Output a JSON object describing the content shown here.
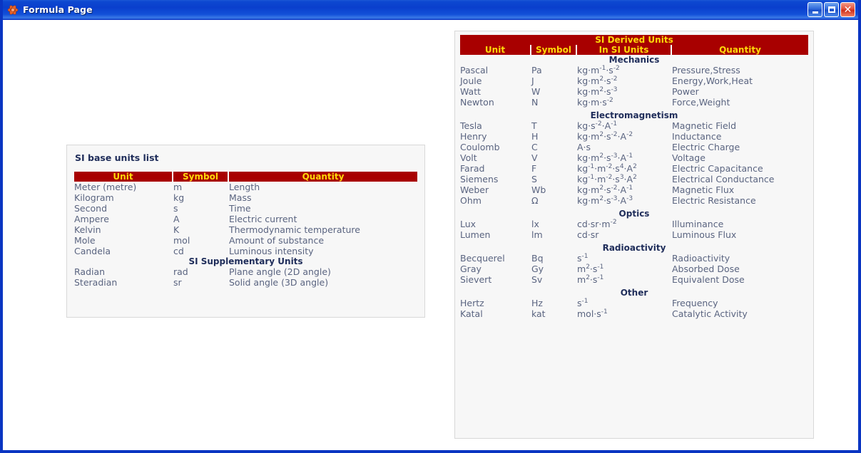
{
  "window": {
    "title": "Formula Page",
    "icon": "atom-icon",
    "buttons": {
      "minimize": "Minimize",
      "maximize": "Maximize",
      "close": "Close"
    },
    "colors": {
      "titlebar_blue": "#0a3fcd",
      "border_blue": "#0a35c2",
      "table_header_red": "#a80000",
      "header_text_yellow": "#ffd90a",
      "section_text_navy": "#1f2d5a",
      "body_text_slate": "#5a6480",
      "panel_background": "#f7f7f7"
    }
  },
  "base_units_panel": {
    "heading": "SI base units list",
    "columns": [
      "Unit",
      "Symbol",
      "Quantity"
    ],
    "rows": [
      {
        "unit": "Meter (metre)",
        "symbol": "m",
        "quantity": "Length"
      },
      {
        "unit": "Kilogram",
        "symbol": "kg",
        "quantity": "Mass"
      },
      {
        "unit": "Second",
        "symbol": "s",
        "quantity": "Time"
      },
      {
        "unit": "Ampere",
        "symbol": "A",
        "quantity": "Electric current"
      },
      {
        "unit": "Kelvin",
        "symbol": "K",
        "quantity": "Thermodynamic temperature"
      },
      {
        "unit": "Mole",
        "symbol": "mol",
        "quantity": "Amount of substance"
      },
      {
        "unit": "Candela",
        "symbol": "cd",
        "quantity": "Luminous intensity"
      }
    ],
    "supplementary_section": "SI Supplementary Units",
    "supplementary_rows": [
      {
        "unit": "Radian",
        "symbol": "rad",
        "quantity": "Plane angle (2D angle)"
      },
      {
        "unit": "Steradian",
        "symbol": "sr",
        "quantity": "Solid angle (3D angle)"
      }
    ]
  },
  "derived_units_panel": {
    "title": "SI Derived Units",
    "columns": [
      "Unit",
      "Symbol",
      "In SI Units",
      "Quantity"
    ],
    "sections": [
      {
        "name": "Mechanics",
        "rows": [
          {
            "unit": "Pascal",
            "symbol": "Pa",
            "si": "kg·m<sup>-1</sup>·s<sup>-2</sup>",
            "quantity": "Pressure,Stress"
          },
          {
            "unit": "Joule",
            "symbol": "J",
            "si": "kg·m<sup>2</sup>·s<sup>-2</sup>",
            "quantity": "Energy,Work,Heat"
          },
          {
            "unit": "Watt",
            "symbol": "W",
            "si": "kg·m<sup>2</sup>·s<sup>-3</sup>",
            "quantity": "Power"
          },
          {
            "unit": "Newton",
            "symbol": "N",
            "si": "kg·m·s<sup>-2</sup>",
            "quantity": "Force,Weight"
          }
        ]
      },
      {
        "name": "Electromagnetism",
        "rows": [
          {
            "unit": "Tesla",
            "symbol": "T",
            "si": "kg·s<sup>-2</sup>·A<sup>-1</sup>",
            "quantity": "Magnetic Field"
          },
          {
            "unit": "Henry",
            "symbol": "H",
            "si": "kg·m<sup>2</sup>·s<sup>-2</sup>·A<sup>-2</sup>",
            "quantity": "Inductance"
          },
          {
            "unit": "Coulomb",
            "symbol": "C",
            "si": "A·s",
            "quantity": "Electric Charge"
          },
          {
            "unit": "Volt",
            "symbol": "V",
            "si": "kg·m<sup>2</sup>·s<sup>-3</sup>·A<sup>-1</sup>",
            "quantity": "Voltage"
          },
          {
            "unit": "Farad",
            "symbol": "F",
            "si": "kg<sup>-1</sup>·m<sup>-2</sup>·s<sup>4</sup>·A<sup>2</sup>",
            "quantity": "Electric Capacitance"
          },
          {
            "unit": "Siemens",
            "symbol": "S",
            "si": "kg<sup>-1</sup>·m<sup>-2</sup>·s<sup>3</sup>·A<sup>2</sup>",
            "quantity": "Electrical Conductance"
          },
          {
            "unit": "Weber",
            "symbol": "Wb",
            "si": "kg·m<sup>2</sup>·s<sup>-2</sup>·A<sup>-1</sup>",
            "quantity": "Magnetic Flux"
          },
          {
            "unit": "Ohm",
            "symbol": "Ω",
            "si": "kg·m<sup>2</sup>·s<sup>-3</sup>·A<sup>-3</sup>",
            "quantity": "Electric Resistance"
          }
        ]
      },
      {
        "name": "Optics",
        "rows": [
          {
            "unit": "Lux",
            "symbol": "lx",
            "si": "cd·sr·m<sup>-2</sup>",
            "quantity": "Illuminance"
          },
          {
            "unit": "Lumen",
            "symbol": "lm",
            "si": "cd·sr",
            "quantity": "Luminous Flux"
          }
        ]
      },
      {
        "name": "Radioactivity",
        "rows": [
          {
            "unit": "Becquerel",
            "symbol": "Bq",
            "si": "s<sup>-1</sup>",
            "quantity": "Radioactivity"
          },
          {
            "unit": "Gray",
            "symbol": "Gy",
            "si": "m<sup>2</sup>·s<sup>-1</sup>",
            "quantity": "Absorbed Dose"
          },
          {
            "unit": "Sievert",
            "symbol": "Sv",
            "si": "m<sup>2</sup>·s<sup>-1</sup>",
            "quantity": "Equivalent Dose"
          }
        ]
      },
      {
        "name": "Other",
        "rows": [
          {
            "unit": "Hertz",
            "symbol": "Hz",
            "si": "s<sup>-1</sup>",
            "quantity": "Frequency"
          },
          {
            "unit": "Katal",
            "symbol": "kat",
            "si": "mol·s<sup>-1</sup>",
            "quantity": "Catalytic Activity"
          }
        ]
      }
    ]
  }
}
